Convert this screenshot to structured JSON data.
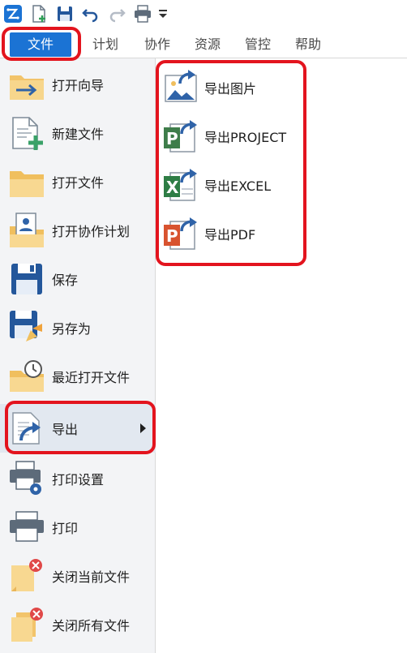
{
  "app": {
    "logo_icon": "app-logo-icon"
  },
  "quick_access": {
    "buttons": [
      "new-file-icon",
      "save-icon",
      "undo-icon",
      "redo-icon",
      "print-icon",
      "customize-dropdown-icon"
    ]
  },
  "tabs": [
    {
      "label": "文件",
      "active": true
    },
    {
      "label": "计划"
    },
    {
      "label": "协作"
    },
    {
      "label": "资源"
    },
    {
      "label": "管控"
    },
    {
      "label": "帮助"
    }
  ],
  "file_menu": {
    "items": [
      {
        "label": "打开向导",
        "icon": "open-wizard-icon"
      },
      {
        "label": "新建文件",
        "icon": "new-document-icon"
      },
      {
        "label": "打开文件",
        "icon": "open-folder-icon"
      },
      {
        "label": "打开协作计划",
        "icon": "open-collab-plan-icon"
      },
      {
        "label": "保存",
        "icon": "save-icon"
      },
      {
        "label": "另存为",
        "icon": "save-as-icon"
      },
      {
        "label": "最近打开文件",
        "icon": "recent-files-icon"
      },
      {
        "label": "导出",
        "icon": "export-icon",
        "has_submenu": true,
        "active": true
      },
      {
        "label": "打印设置",
        "icon": "print-settings-icon"
      },
      {
        "label": "打印",
        "icon": "print-icon"
      },
      {
        "label": "关闭当前文件",
        "icon": "close-current-file-icon"
      },
      {
        "label": "关闭所有文件",
        "icon": "close-all-files-icon"
      }
    ]
  },
  "export_submenu": {
    "items": [
      {
        "label": "导出图片",
        "icon": "export-image-icon"
      },
      {
        "label": "导出PROJECT",
        "icon": "export-project-icon"
      },
      {
        "label": "导出EXCEL",
        "icon": "export-excel-icon"
      },
      {
        "label": "导出PDF",
        "icon": "export-pdf-icon"
      }
    ]
  },
  "colors": {
    "accent": "#1b73d4",
    "highlight": "#e3141e",
    "menu_bg": "#f3f4f6",
    "active_item_bg": "#e2e8f0"
  }
}
